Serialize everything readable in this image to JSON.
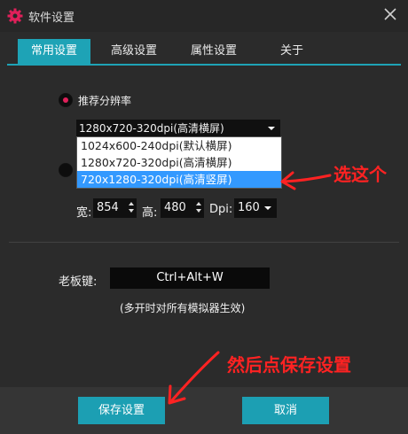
{
  "window": {
    "title": "软件设置"
  },
  "tabs": [
    "常用设置",
    "高级设置",
    "属性设置",
    "关于"
  ],
  "resolution": {
    "recommended_label": "推荐分辨率",
    "selected": "1280x720-320dpi(高清横屏)",
    "options": [
      "1024x600-240dpi(默认横屏)",
      "1280x720-320dpi(高清横屏)",
      "720x1280-320dpi(高清竖屏)"
    ],
    "highlighted_index": 2
  },
  "custom": {
    "width_label": "宽:",
    "width": "854",
    "height_label": "高:",
    "height": "480",
    "dpi_label": "Dpi:",
    "dpi": "160"
  },
  "boss_key": {
    "label": "老板键:",
    "value": "Ctrl+Alt+W",
    "note": "(多开时对所有模拟器生效)"
  },
  "buttons": {
    "save": "保存设置",
    "cancel": "取消"
  },
  "annotations": {
    "choose_this": "选这个",
    "then_save": "然后点保存设置",
    "color": "#ff2222"
  },
  "colors": {
    "accent": "#1ea3b6",
    "radio_selected": "#e0205a",
    "highlight": "#3399ff"
  }
}
